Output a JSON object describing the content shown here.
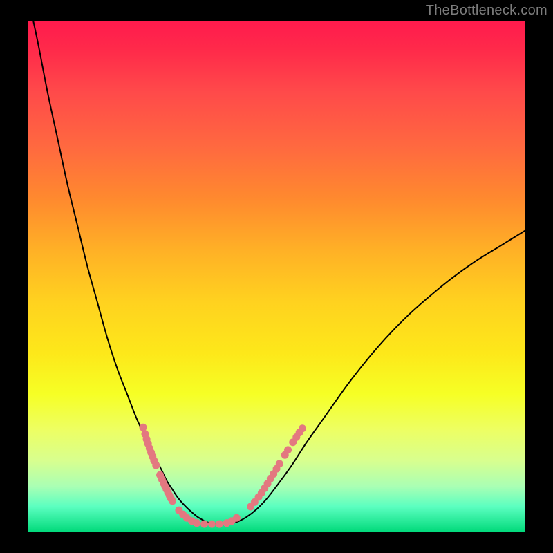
{
  "watermark": "TheBottleneck.com",
  "colors": {
    "curve": "#000000",
    "marker": "#e37880",
    "frame_bg": "#000000"
  },
  "chart_data": {
    "type": "line",
    "title": "",
    "xlabel": "",
    "ylabel": "",
    "xlim": [
      0,
      100
    ],
    "ylim": [
      0,
      100
    ],
    "grid": false,
    "legend": false,
    "series": [
      {
        "name": "bottleneck-curve",
        "x": [
          0,
          2,
          4,
          6,
          8,
          10,
          12,
          14,
          16,
          18,
          20,
          22,
          24,
          26,
          27,
          28,
          29,
          30,
          31,
          32,
          33,
          34,
          35,
          36,
          37,
          38,
          40,
          42,
          44,
          46,
          48,
          50,
          53,
          56,
          60,
          64,
          68,
          72,
          76,
          80,
          85,
          90,
          95,
          100
        ],
        "y": [
          105,
          96,
          86,
          77,
          68,
          60,
          52,
          45,
          38,
          32,
          27,
          22,
          18,
          14,
          12,
          10,
          8.5,
          7,
          5.8,
          4.8,
          3.9,
          3.1,
          2.5,
          2.0,
          1.7,
          1.6,
          1.6,
          2.0,
          3.0,
          4.5,
          6.5,
          9,
          13,
          17.5,
          23,
          28.5,
          33.5,
          38,
          42,
          45.5,
          49.5,
          53,
          56,
          59
        ]
      }
    ],
    "markers": [
      {
        "x": 23.2,
        "y": 20.5
      },
      {
        "x": 23.6,
        "y": 19.2
      },
      {
        "x": 23.9,
        "y": 18.2
      },
      {
        "x": 24.2,
        "y": 17.3
      },
      {
        "x": 24.5,
        "y": 16.4
      },
      {
        "x": 24.8,
        "y": 15.6
      },
      {
        "x": 25.1,
        "y": 14.8
      },
      {
        "x": 25.4,
        "y": 14.0
      },
      {
        "x": 25.8,
        "y": 13.1
      },
      {
        "x": 26.6,
        "y": 11.2
      },
      {
        "x": 27.0,
        "y": 10.3
      },
      {
        "x": 27.3,
        "y": 9.6
      },
      {
        "x": 27.6,
        "y": 9.0
      },
      {
        "x": 27.9,
        "y": 8.4
      },
      {
        "x": 28.2,
        "y": 7.8
      },
      {
        "x": 28.5,
        "y": 7.2
      },
      {
        "x": 28.8,
        "y": 6.6
      },
      {
        "x": 29.1,
        "y": 6.1
      },
      {
        "x": 30.4,
        "y": 4.3
      },
      {
        "x": 31.2,
        "y": 3.5
      },
      {
        "x": 32.0,
        "y": 2.8
      },
      {
        "x": 33.0,
        "y": 2.2
      },
      {
        "x": 34.0,
        "y": 1.8
      },
      {
        "x": 35.5,
        "y": 1.6
      },
      {
        "x": 37.0,
        "y": 1.6
      },
      {
        "x": 38.5,
        "y": 1.6
      },
      {
        "x": 40.0,
        "y": 1.8
      },
      {
        "x": 41.0,
        "y": 2.2
      },
      {
        "x": 42.0,
        "y": 2.8
      },
      {
        "x": 44.8,
        "y": 5.0
      },
      {
        "x": 45.6,
        "y": 5.9
      },
      {
        "x": 46.4,
        "y": 6.9
      },
      {
        "x": 47.0,
        "y": 7.7
      },
      {
        "x": 47.6,
        "y": 8.6
      },
      {
        "x": 48.2,
        "y": 9.5
      },
      {
        "x": 48.8,
        "y": 10.5
      },
      {
        "x": 49.4,
        "y": 11.4
      },
      {
        "x": 50.0,
        "y": 12.4
      },
      {
        "x": 50.6,
        "y": 13.4
      },
      {
        "x": 51.7,
        "y": 15.1
      },
      {
        "x": 52.3,
        "y": 16.1
      },
      {
        "x": 53.3,
        "y": 17.6
      },
      {
        "x": 54.0,
        "y": 18.6
      },
      {
        "x": 54.6,
        "y": 19.5
      },
      {
        "x": 55.2,
        "y": 20.3
      }
    ]
  }
}
